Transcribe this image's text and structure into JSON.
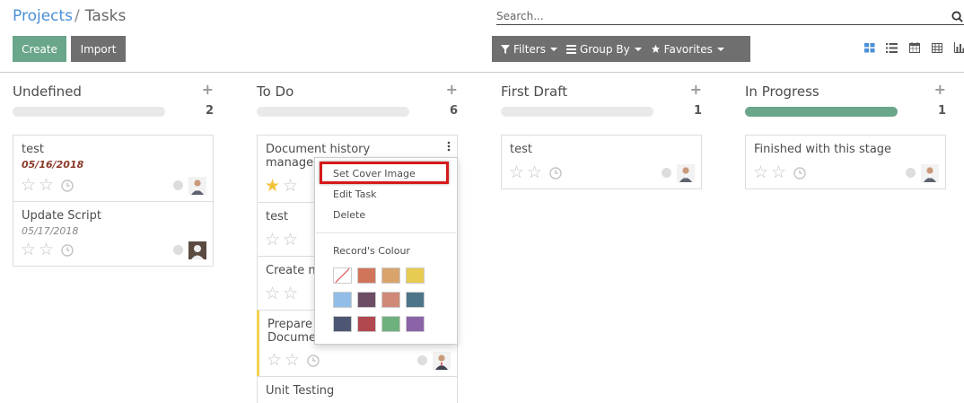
{
  "breadcrumb": {
    "parent": "Projects",
    "separator": "/",
    "current": "Tasks"
  },
  "search": {
    "placeholder": "Search..."
  },
  "buttons": {
    "create": "Create",
    "import": "Import"
  },
  "search_options": {
    "filters": "Filters",
    "group_by": "Group By",
    "favorites": "Favorites"
  },
  "view_icons": [
    "kanban-view-icon",
    "list-view-icon",
    "calendar-view-icon",
    "pivot-view-icon",
    "graph-view-icon"
  ],
  "colors": {
    "primary": "#6aa68a",
    "secondary": "#6f6f6f",
    "link": "#4b8fd6",
    "highlight": "#d51a1a",
    "star": "#f3c33b"
  },
  "columns": [
    {
      "title": "Undefined",
      "count": "2",
      "progress": 0
    },
    {
      "title": "To Do",
      "count": "6",
      "progress": 0
    },
    {
      "title": "First Draft",
      "count": "1",
      "progress": 0
    },
    {
      "title": "In Progress",
      "count": "1",
      "progress": 1
    }
  ],
  "cards": {
    "undefined": [
      {
        "title": "test",
        "date": "05/16/2018"
      },
      {
        "title": "Update Script",
        "date": "05/17/2018"
      }
    ],
    "todo": [
      {
        "title_line1": "Document history",
        "title_line2": "manager"
      },
      {
        "title": "test"
      },
      {
        "title": "Create n"
      },
      {
        "title_line1": "Prepare",
        "title_line2": "Documen"
      },
      {
        "title": "Unit Testing"
      }
    ],
    "first_draft": [
      {
        "title": "test"
      }
    ],
    "in_progress": [
      {
        "title": "Finished with this stage"
      }
    ]
  },
  "dropdown": {
    "set_cover_image": "Set Cover Image",
    "edit_task": "Edit Task",
    "delete": "Delete",
    "records_colour": "Record's Colour",
    "swatch_colors": [
      "#ffffff",
      "#d0755a",
      "#d8a46c",
      "#e8cc51",
      "#92bde6",
      "#6c4d63",
      "#d08978",
      "#4d7589",
      "#4d5673",
      "#b1474f",
      "#6fb17e",
      "#8b64a8"
    ]
  }
}
